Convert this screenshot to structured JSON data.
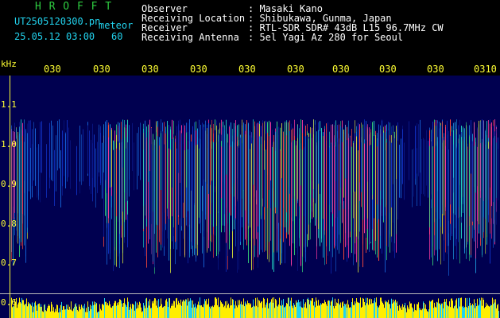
{
  "header": {
    "station": "H R O F F T",
    "filename": "UT2505120300.pn",
    "filename_suffix": "meteor",
    "datetime": "25.05.12 03:00",
    "interval": "60",
    "fields": [
      {
        "label": "Observer",
        "value": ": Masaki Kano"
      },
      {
        "label": "Receiving Location",
        "value": ": Shibukawa, Gunma, Japan"
      },
      {
        "label": "Receiver",
        "value": ": RTL-SDR SDR# 43dB L15 96.7MHz CW"
      },
      {
        "label": "Receiving Antenna",
        "value": ": 5el Yagi Az 280 for Seoul"
      }
    ]
  },
  "axes": {
    "y_unit": "kHz",
    "y_ticks": [
      "1.1",
      "1.0",
      "0.9",
      "0.8",
      "0.7",
      "0.6"
    ],
    "x_ticks": [
      "030",
      "030",
      "030",
      "030",
      "030",
      "030",
      "030",
      "030",
      "030",
      "0310"
    ]
  },
  "colors": {
    "background": "#000000",
    "plot_background": "#000050",
    "title_green": "#2ecc40",
    "label_white": "#ffffff",
    "info_cyan": "#22d3ee",
    "axis_yellow": "#ffff33"
  }
}
